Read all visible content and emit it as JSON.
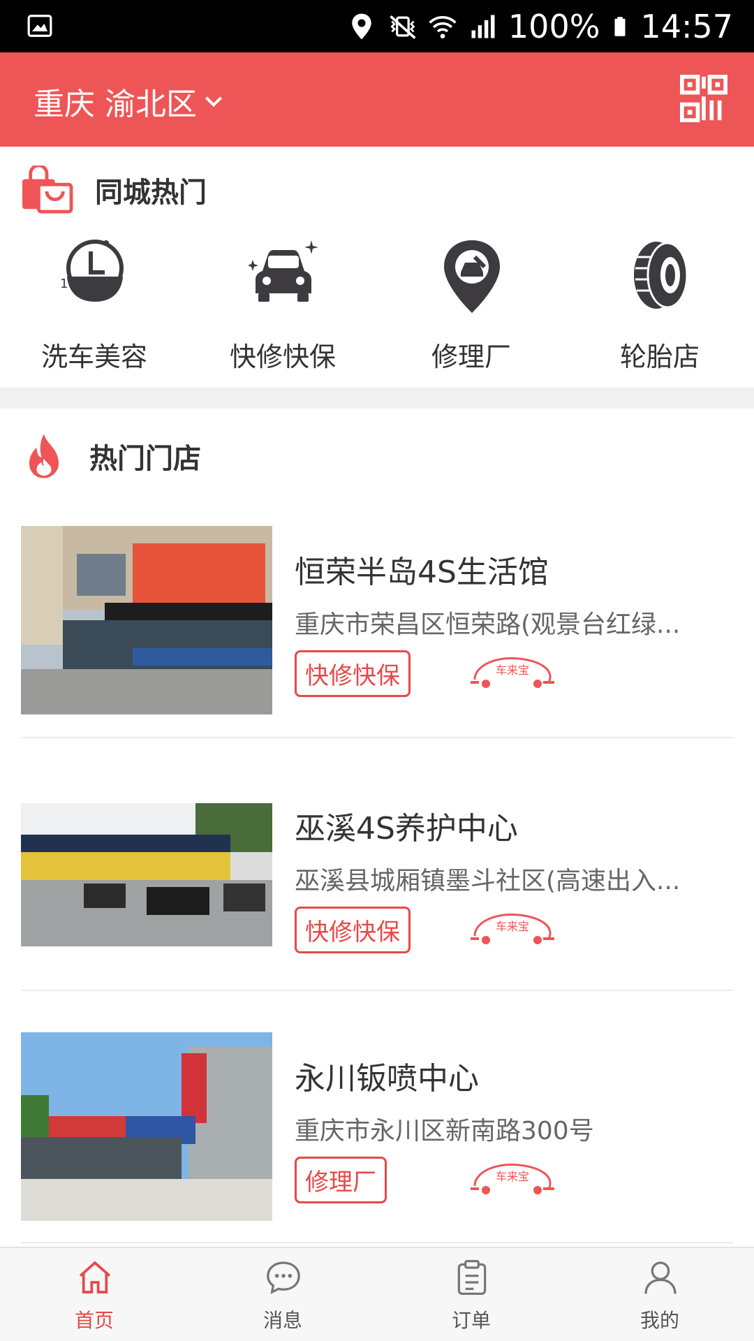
{
  "status_bar": {
    "battery": "100%",
    "time": "14:57"
  },
  "header": {
    "location": "重庆 渝北区"
  },
  "hot_city": {
    "title": "同城热门",
    "categories": [
      {
        "label": "洗车美容",
        "icon": "car-wash-clock-icon"
      },
      {
        "label": "快修快保",
        "icon": "car-sparkle-icon"
      },
      {
        "label": "修理厂",
        "icon": "repair-location-pin-icon"
      },
      {
        "label": "轮胎店",
        "icon": "tire-icon"
      }
    ]
  },
  "hot_stores": {
    "title": "热门门店",
    "stores": [
      {
        "name": "恒荣半岛4S生活馆",
        "address": "重庆市荣昌区恒荣路(观景台红绿...",
        "tag": "快修快保",
        "brand": "车来宝"
      },
      {
        "name": "巫溪4S养护中心",
        "address": "巫溪县城厢镇墨斗社区(高速出入...",
        "tag": "快修快保",
        "brand": "车来宝"
      },
      {
        "name": "永川钣喷中心",
        "address": "重庆市永川区新南路300号",
        "tag": "修理厂",
        "brand": "车来宝"
      }
    ]
  },
  "tabbar": {
    "tabs": [
      {
        "label": "首页",
        "icon": "home-icon",
        "active": true
      },
      {
        "label": "消息",
        "icon": "message-icon",
        "active": false
      },
      {
        "label": "订单",
        "icon": "order-icon",
        "active": false
      },
      {
        "label": "我的",
        "icon": "user-icon",
        "active": false
      }
    ]
  },
  "colors": {
    "brand_red": "#ee5556",
    "tag_red": "#e8484a",
    "icon_dark": "#3d3a40"
  }
}
